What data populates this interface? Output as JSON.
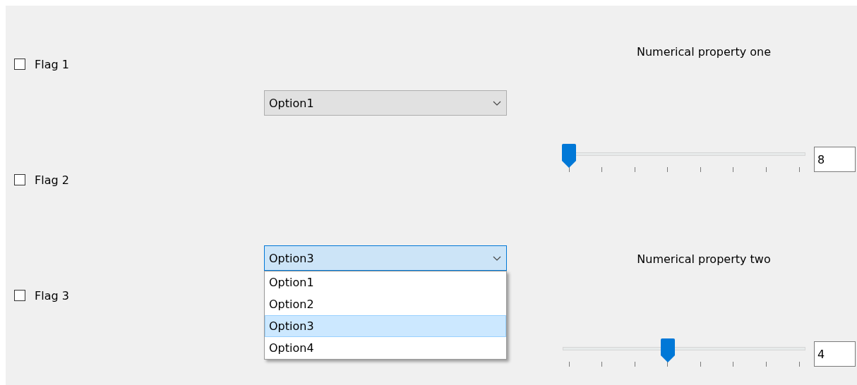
{
  "checkboxes": [
    {
      "label": "Flag 1",
      "checked": false
    },
    {
      "label": "Flag 2",
      "checked": false
    },
    {
      "label": "Flag 3",
      "checked": false
    }
  ],
  "dropdowns": [
    {
      "value": "Option1",
      "expanded": false
    },
    {
      "value": "Option3",
      "expanded": true,
      "options": [
        {
          "label": "Option1",
          "selected": false
        },
        {
          "label": "Option2",
          "selected": false
        },
        {
          "label": "Option3",
          "selected": true
        },
        {
          "label": "Option4",
          "selected": false
        }
      ]
    }
  ],
  "sliders": [
    {
      "label": "Numerical property one",
      "level": 0,
      "value": "8"
    },
    {
      "label": "Numerical property two",
      "level": 0.43,
      "value": "4"
    }
  ]
}
